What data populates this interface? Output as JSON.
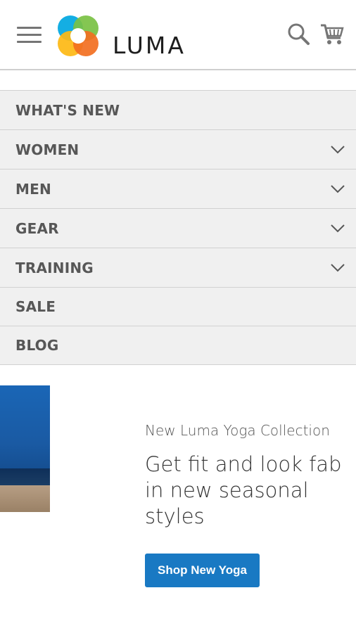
{
  "header": {
    "brand": "LUMA",
    "icons": {
      "menu": "hamburger-menu-icon",
      "search": "search-icon",
      "cart": "cart-icon"
    },
    "logo_colors": [
      "#f26f21",
      "#fdb913",
      "#7ac143",
      "#00a7e1"
    ]
  },
  "nav": {
    "items": [
      {
        "label": "WHAT'S NEW",
        "has_submenu": false
      },
      {
        "label": "WOMEN",
        "has_submenu": true
      },
      {
        "label": "MEN",
        "has_submenu": true
      },
      {
        "label": "GEAR",
        "has_submenu": true
      },
      {
        "label": "TRAINING",
        "has_submenu": true
      },
      {
        "label": "SALE",
        "has_submenu": false
      },
      {
        "label": "BLOG",
        "has_submenu": false
      }
    ]
  },
  "hero": {
    "subtitle": "New Luma Yoga Collection",
    "title": "Get fit and look fab in new seasonal styles",
    "button_label": "Shop New Yoga"
  },
  "colors": {
    "accent": "#1979c3",
    "nav_bg": "#f0f0f0"
  }
}
